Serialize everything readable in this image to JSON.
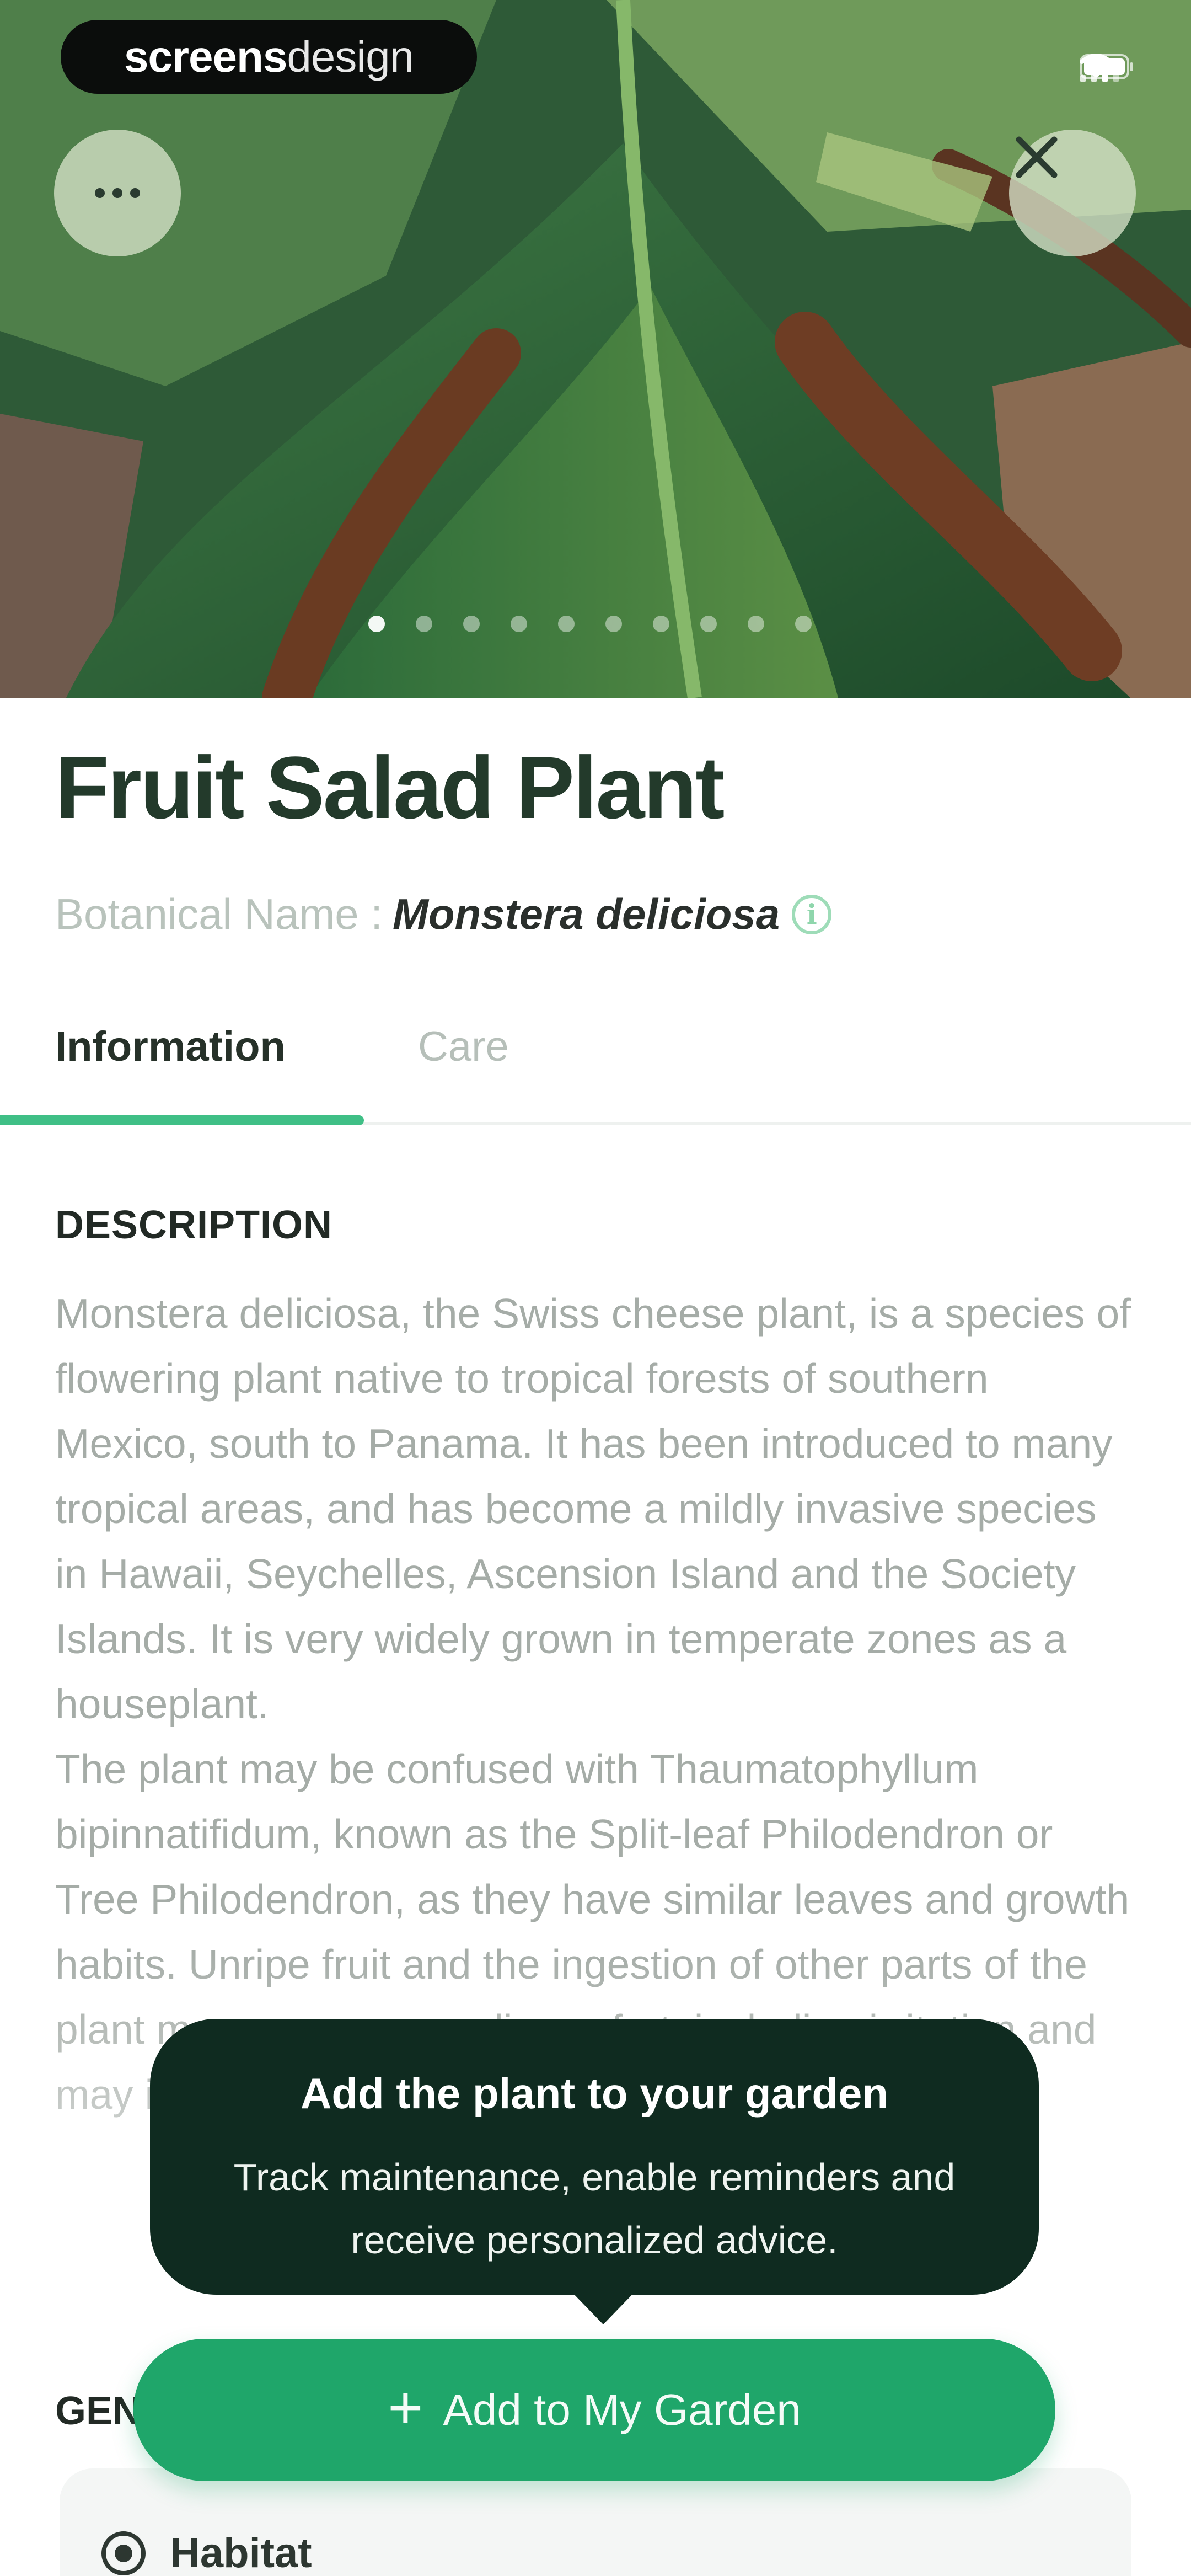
{
  "brand": {
    "bold": "screens",
    "regular": "design"
  },
  "plant": {
    "common_name": "Fruit Salad Plant",
    "botanical_label": "Botanical Name :",
    "botanical_name": "Monstera deliciosa"
  },
  "tabs": [
    {
      "label": "Information",
      "active": true
    },
    {
      "label": "Care",
      "active": false
    }
  ],
  "carousel": {
    "total": 10,
    "active_index": 0
  },
  "description": {
    "heading": "DESCRIPTION",
    "paragraphs": [
      "Monstera deliciosa, the Swiss cheese plant, is a species of flowering plant native to tropical forests of southern Mexico, south to Panama. It has been introduced to many tropical areas, and has become a mildly invasive species in Hawaii, Seychelles, Ascension Island and the Society Islands. It is very widely grown in temperate zones as a houseplant.",
      "The plant may be confused with Thaumatophyllum bipinnatifidum, known as the Split-leaf Philodendron or Tree Philodendron, as they have similar leaves and growth habits. Unripe fruit and the ingestion of other parts of the plant may cause some discomfort, including irritation and may induce vomiting; the plant is known to irritate"
    ]
  },
  "general": {
    "heading": "GEN",
    "habitat_label": "Habitat"
  },
  "tooltip": {
    "title": "Add the plant to your garden",
    "body": "Track maintenance, enable reminders and receive personalized advice."
  },
  "cta": {
    "label": "Add to My Garden"
  },
  "colors": {
    "accent": "#1fa66a",
    "tab_indicator": "#3fbf86",
    "tooltip_bg": "#0f2b20",
    "title_text": "#233a2b"
  }
}
